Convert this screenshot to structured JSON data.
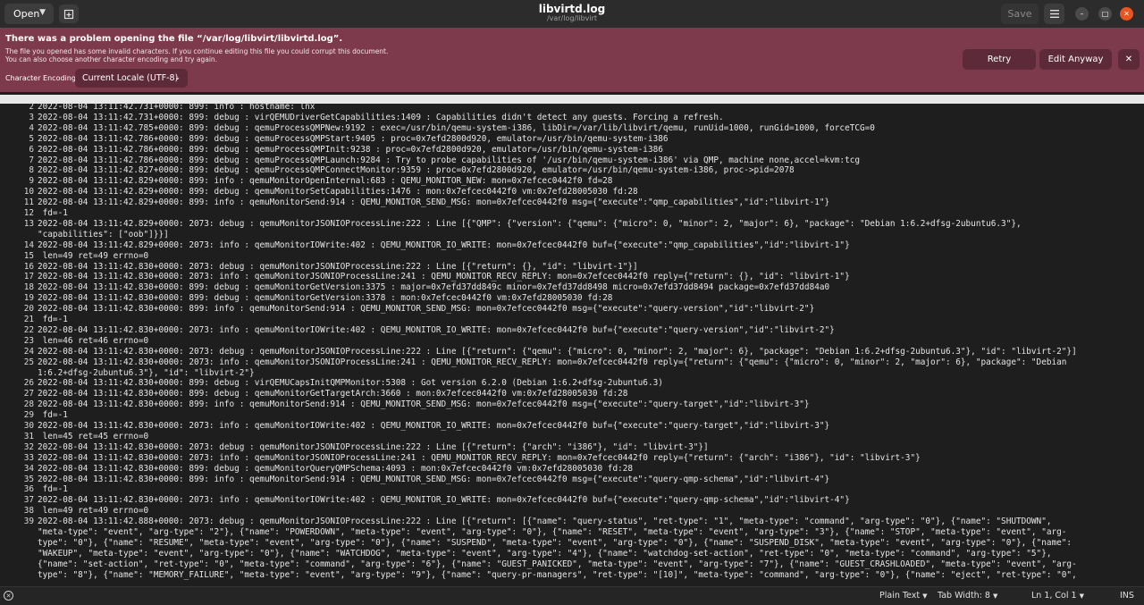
{
  "header": {
    "open_label": "Open",
    "title": "libvirtd.log",
    "subtitle": "/var/log/libvirt",
    "save_label": "Save"
  },
  "infobar": {
    "title": "There was a problem opening the file “/var/log/libvirt/libvirtd.log”.",
    "desc_line1": "The file you opened has some invalid characters. If you continue editing this file you could corrupt this document.",
    "desc_line2": "You can also choose another character encoding and try again.",
    "encoding_label": "Character Encoding:",
    "encoding_value": "Current Locale (UTF-8)",
    "retry_label": "Retry",
    "edit_anyway_label": "Edit Anyway"
  },
  "lines": [
    {
      "n": "2",
      "t": "2022-08-04 13:11:42.731+0000: 899: info : hostname: lnx"
    },
    {
      "n": "3",
      "t": "2022-08-04 13:11:42.731+0000: 899: debug : virQEMUDriverGetCapabilities:1409 : Capabilities didn't detect any guests. Forcing a refresh."
    },
    {
      "n": "4",
      "t": "2022-08-04 13:11:42.785+0000: 899: debug : qemuProcessQMPNew:9192 : exec=/usr/bin/qemu-system-i386, libDir=/var/lib/libvirt/qemu, runUid=1000, runGid=1000, forceTCG=0"
    },
    {
      "n": "5",
      "t": "2022-08-04 13:11:42.786+0000: 899: debug : qemuProcessQMPStart:9405 : proc=0x7efd2800d920, emulator=/usr/bin/qemu-system-i386"
    },
    {
      "n": "6",
      "t": "2022-08-04 13:11:42.786+0000: 899: debug : qemuProcessQMPInit:9238 : proc=0x7efd2800d920, emulator=/usr/bin/qemu-system-i386"
    },
    {
      "n": "7",
      "t": "2022-08-04 13:11:42.786+0000: 899: debug : qemuProcessQMPLaunch:9284 : Try to probe capabilities of '/usr/bin/qemu-system-i386' via QMP, machine none,accel=kvm:tcg"
    },
    {
      "n": "8",
      "t": "2022-08-04 13:11:42.827+0000: 899: debug : qemuProcessQMPConnectMonitor:9359 : proc=0x7efd2800d920, emulator=/usr/bin/qemu-system-i386, proc->pid=2078"
    },
    {
      "n": "9",
      "t": "2022-08-04 13:11:42.829+0000: 899: info : qemuMonitorOpenInternal:683 : QEMU_MONITOR_NEW: mon=0x7efcec0442f0 fd=28"
    },
    {
      "n": "10",
      "t": "2022-08-04 13:11:42.829+0000: 899: debug : qemuMonitorSetCapabilities:1476 : mon:0x7efcec0442f0 vm:0x7efd28005030 fd:28"
    },
    {
      "n": "11",
      "t": "2022-08-04 13:11:42.829+0000: 899: info : qemuMonitorSend:914 : QEMU_MONITOR_SEND_MSG: mon=0x7efcec0442f0 msg={\"execute\":\"qmp_capabilities\",\"id\":\"libvirt-1\"}"
    },
    {
      "n": "12",
      "t": " fd=-1"
    },
    {
      "n": "13",
      "t": "2022-08-04 13:11:42.829+0000: 2073: debug : qemuMonitorJSONIOProcessLine:222 : Line [{\"QMP\": {\"version\": {\"qemu\": {\"micro\": 0, \"minor\": 2, \"major\": 6}, \"package\": \"Debian 1:6.2+dfsg-2ubuntu6.3\"},"
    },
    {
      "n": "",
      "t": "\"capabilities\": [\"oob\"]}}]"
    },
    {
      "n": "14",
      "t": "2022-08-04 13:11:42.829+0000: 2073: info : qemuMonitorIOWrite:402 : QEMU_MONITOR_IO_WRITE: mon=0x7efcec0442f0 buf={\"execute\":\"qmp_capabilities\",\"id\":\"libvirt-1\"}"
    },
    {
      "n": "15",
      "t": " len=49 ret=49 errno=0"
    },
    {
      "n": "16",
      "t": "2022-08-04 13:11:42.830+0000: 2073: debug : qemuMonitorJSONIOProcessLine:222 : Line [{\"return\": {}, \"id\": \"libvirt-1\"}]"
    },
    {
      "n": "17",
      "t": "2022-08-04 13:11:42.830+0000: 2073: info : qemuMonitorJSONIOProcessLine:241 : QEMU_MONITOR_RECV_REPLY: mon=0x7efcec0442f0 reply={\"return\": {}, \"id\": \"libvirt-1\"}"
    },
    {
      "n": "18",
      "t": "2022-08-04 13:11:42.830+0000: 899: debug : qemuMonitorGetVersion:3375 : major=0x7efd37dd849c minor=0x7efd37dd8498 micro=0x7efd37dd8494 package=0x7efd37dd84a0"
    },
    {
      "n": "19",
      "t": "2022-08-04 13:11:42.830+0000: 899: debug : qemuMonitorGetVersion:3378 : mon:0x7efcec0442f0 vm:0x7efd28005030 fd:28"
    },
    {
      "n": "20",
      "t": "2022-08-04 13:11:42.830+0000: 899: info : qemuMonitorSend:914 : QEMU_MONITOR_SEND_MSG: mon=0x7efcec0442f0 msg={\"execute\":\"query-version\",\"id\":\"libvirt-2\"}"
    },
    {
      "n": "21",
      "t": " fd=-1"
    },
    {
      "n": "22",
      "t": "2022-08-04 13:11:42.830+0000: 2073: info : qemuMonitorIOWrite:402 : QEMU_MONITOR_IO_WRITE: mon=0x7efcec0442f0 buf={\"execute\":\"query-version\",\"id\":\"libvirt-2\"}"
    },
    {
      "n": "23",
      "t": " len=46 ret=46 errno=0"
    },
    {
      "n": "24",
      "t": "2022-08-04 13:11:42.830+0000: 2073: debug : qemuMonitorJSONIOProcessLine:222 : Line [{\"return\": {\"qemu\": {\"micro\": 0, \"minor\": 2, \"major\": 6}, \"package\": \"Debian 1:6.2+dfsg-2ubuntu6.3\"}, \"id\": \"libvirt-2\"}]"
    },
    {
      "n": "25",
      "t": "2022-08-04 13:11:42.830+0000: 2073: info : qemuMonitorJSONIOProcessLine:241 : QEMU_MONITOR_RECV_REPLY: mon=0x7efcec0442f0 reply={\"return\": {\"qemu\": {\"micro\": 0, \"minor\": 2, \"major\": 6}, \"package\": \"Debian"
    },
    {
      "n": "",
      "t": "1:6.2+dfsg-2ubuntu6.3\"}, \"id\": \"libvirt-2\"}"
    },
    {
      "n": "26",
      "t": "2022-08-04 13:11:42.830+0000: 899: debug : virQEMUCapsInitQMPMonitor:5308 : Got version 6.2.0 (Debian 1:6.2+dfsg-2ubuntu6.3)"
    },
    {
      "n": "27",
      "t": "2022-08-04 13:11:42.830+0000: 899: debug : qemuMonitorGetTargetArch:3660 : mon:0x7efcec0442f0 vm:0x7efd28005030 fd:28"
    },
    {
      "n": "28",
      "t": "2022-08-04 13:11:42.830+0000: 899: info : qemuMonitorSend:914 : QEMU_MONITOR_SEND_MSG: mon=0x7efcec0442f0 msg={\"execute\":\"query-target\",\"id\":\"libvirt-3\"}"
    },
    {
      "n": "29",
      "t": " fd=-1"
    },
    {
      "n": "30",
      "t": "2022-08-04 13:11:42.830+0000: 2073: info : qemuMonitorIOWrite:402 : QEMU_MONITOR_IO_WRITE: mon=0x7efcec0442f0 buf={\"execute\":\"query-target\",\"id\":\"libvirt-3\"}"
    },
    {
      "n": "31",
      "t": " len=45 ret=45 errno=0"
    },
    {
      "n": "32",
      "t": "2022-08-04 13:11:42.830+0000: 2073: debug : qemuMonitorJSONIOProcessLine:222 : Line [{\"return\": {\"arch\": \"i386\"}, \"id\": \"libvirt-3\"}]"
    },
    {
      "n": "33",
      "t": "2022-08-04 13:11:42.830+0000: 2073: info : qemuMonitorJSONIOProcessLine:241 : QEMU_MONITOR_RECV_REPLY: mon=0x7efcec0442f0 reply={\"return\": {\"arch\": \"i386\"}, \"id\": \"libvirt-3\"}"
    },
    {
      "n": "34",
      "t": "2022-08-04 13:11:42.830+0000: 899: debug : qemuMonitorQueryQMPSchema:4093 : mon:0x7efcec0442f0 vm:0x7efd28005030 fd:28"
    },
    {
      "n": "35",
      "t": "2022-08-04 13:11:42.830+0000: 899: info : qemuMonitorSend:914 : QEMU_MONITOR_SEND_MSG: mon=0x7efcec0442f0 msg={\"execute\":\"query-qmp-schema\",\"id\":\"libvirt-4\"}"
    },
    {
      "n": "36",
      "t": " fd=-1"
    },
    {
      "n": "37",
      "t": "2022-08-04 13:11:42.830+0000: 2073: info : qemuMonitorIOWrite:402 : QEMU_MONITOR_IO_WRITE: mon=0x7efcec0442f0 buf={\"execute\":\"query-qmp-schema\",\"id\":\"libvirt-4\"}"
    },
    {
      "n": "38",
      "t": " len=49 ret=49 errno=0"
    },
    {
      "n": "39",
      "t": "2022-08-04 13:11:42.888+0000: 2073: debug : qemuMonitorJSONIOProcessLine:222 : Line [{\"return\": [{\"name\": \"query-status\", \"ret-type\": \"1\", \"meta-type\": \"command\", \"arg-type\": \"0\"}, {\"name\": \"SHUTDOWN\","
    },
    {
      "n": "",
      "t": "\"meta-type\": \"event\", \"arg-type\": \"2\"}, {\"name\": \"POWERDOWN\", \"meta-type\": \"event\", \"arg-type\": \"0\"}, {\"name\": \"RESET\", \"meta-type\": \"event\", \"arg-type\": \"3\"}, {\"name\": \"STOP\", \"meta-type\": \"event\", \"arg-"
    },
    {
      "n": "",
      "t": "type\": \"0\"}, {\"name\": \"RESUME\", \"meta-type\": \"event\", \"arg-type\": \"0\"}, {\"name\": \"SUSPEND\", \"meta-type\": \"event\", \"arg-type\": \"0\"}, {\"name\": \"SUSPEND_DISK\", \"meta-type\": \"event\", \"arg-type\": \"0\"}, {\"name\":"
    },
    {
      "n": "",
      "t": "\"WAKEUP\", \"meta-type\": \"event\", \"arg-type\": \"0\"}, {\"name\": \"WATCHDOG\", \"meta-type\": \"event\", \"arg-type\": \"4\"}, {\"name\": \"watchdog-set-action\", \"ret-type\": \"0\", \"meta-type\": \"command\", \"arg-type\": \"5\"},"
    },
    {
      "n": "",
      "t": "{\"name\": \"set-action\", \"ret-type\": \"0\", \"meta-type\": \"command\", \"arg-type\": \"6\"}, {\"name\": \"GUEST_PANICKED\", \"meta-type\": \"event\", \"arg-type\": \"7\"}, {\"name\": \"GUEST_CRASHLOADED\", \"meta-type\": \"event\", \"arg-"
    },
    {
      "n": "",
      "t": "type\": \"8\"}, {\"name\": \"MEMORY_FAILURE\", \"meta-type\": \"event\", \"arg-type\": \"9\"}, {\"name\": \"query-pr-managers\", \"ret-type\": \"[10]\", \"meta-type\": \"command\", \"arg-type\": \"0\"}, {\"name\": \"eject\", \"ret-type\": \"0\","
    }
  ],
  "statusbar": {
    "language": "Plain Text",
    "tab_width": "Tab Width: 8",
    "position": "Ln 1, Col 1",
    "mode": "INS"
  },
  "colors": {
    "infobar_bg": "#7d3a4c",
    "headerbar_bg": "#2c2c2c",
    "editor_bg": "#1e1e1e",
    "close_button": "#e95420"
  },
  "icons": [
    "chevron-down-icon",
    "new-tab-icon",
    "hamburger-menu-icon",
    "minimize-icon",
    "maximize-icon",
    "close-icon",
    "error-status-icon"
  ]
}
